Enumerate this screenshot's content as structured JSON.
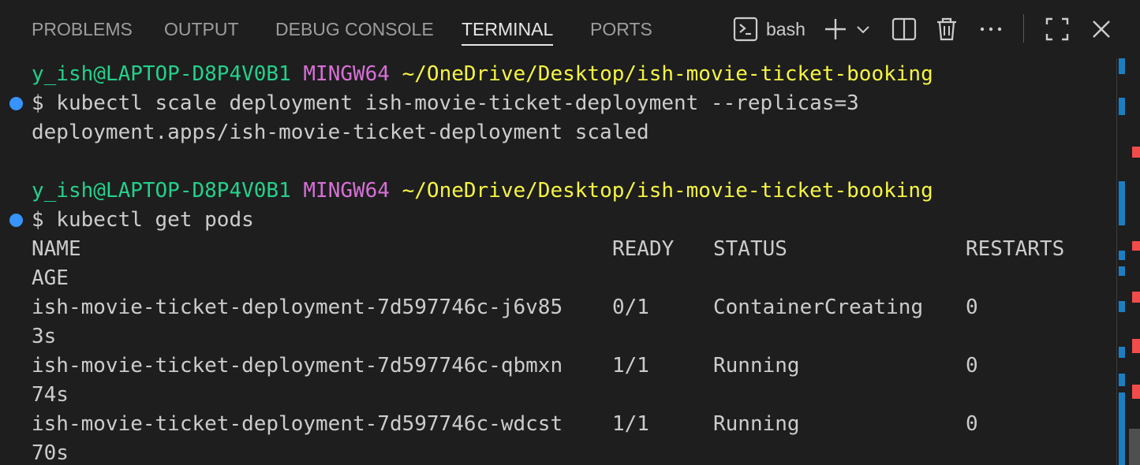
{
  "panel": {
    "tabs": [
      {
        "label": "PROBLEMS"
      },
      {
        "label": "OUTPUT"
      },
      {
        "label": "DEBUG CONSOLE"
      },
      {
        "label": "TERMINAL",
        "active": true
      },
      {
        "label": "PORTS"
      }
    ],
    "actions": {
      "shell_icon": "terminal-icon",
      "shell_label": "bash",
      "new_terminal_icon": "plus-icon",
      "dropdown_icon": "chevron-down-icon",
      "split_icon": "split-panel-icon",
      "kill_icon": "trash-icon",
      "more_icon": "ellipsis-icon",
      "maximize_icon": "maximize-icon",
      "close_icon": "close-icon"
    }
  },
  "terminal": {
    "prompt1": {
      "user": "y_ish@LAPTOP-D8P4V0B1",
      "env": "MINGW64",
      "path": "~/OneDrive/Desktop/ish-movie-ticket-booking"
    },
    "cmd1": "$ kubectl scale deployment ish-movie-ticket-deployment --replicas=3",
    "out1": "deployment.apps/ish-movie-ticket-deployment scaled",
    "prompt2": {
      "user": "y_ish@LAPTOP-D8P4V0B1",
      "env": "MINGW64",
      "path": "~/OneDrive/Desktop/ish-movie-ticket-booking"
    },
    "cmd2": "$ kubectl get pods",
    "table": {
      "headers": {
        "name": "NAME",
        "ready": "READY",
        "status": "STATUS",
        "restarts": "RESTARTS",
        "age": "AGE"
      },
      "rows": [
        {
          "name": "ish-movie-ticket-deployment-7d597746c-j6v85",
          "ready": "0/1",
          "status": "ContainerCreating",
          "restarts": "0",
          "age": "3s"
        },
        {
          "name": "ish-movie-ticket-deployment-7d597746c-qbmxn",
          "ready": "1/1",
          "status": "Running",
          "restarts": "0",
          "age": "74s"
        },
        {
          "name": "ish-movie-ticket-deployment-7d597746c-wdcst",
          "ready": "1/1",
          "status": "Running",
          "restarts": "0",
          "age": "70s"
        }
      ]
    }
  },
  "colors": {
    "background": "#1e1e1e",
    "prompt_user": "#23d18b",
    "prompt_env": "#d670d6",
    "prompt_path": "#f5f543",
    "command_decoration": "#3794ff",
    "ruler_blue": "#1c7fc4",
    "ruler_red": "#f14c4c"
  }
}
